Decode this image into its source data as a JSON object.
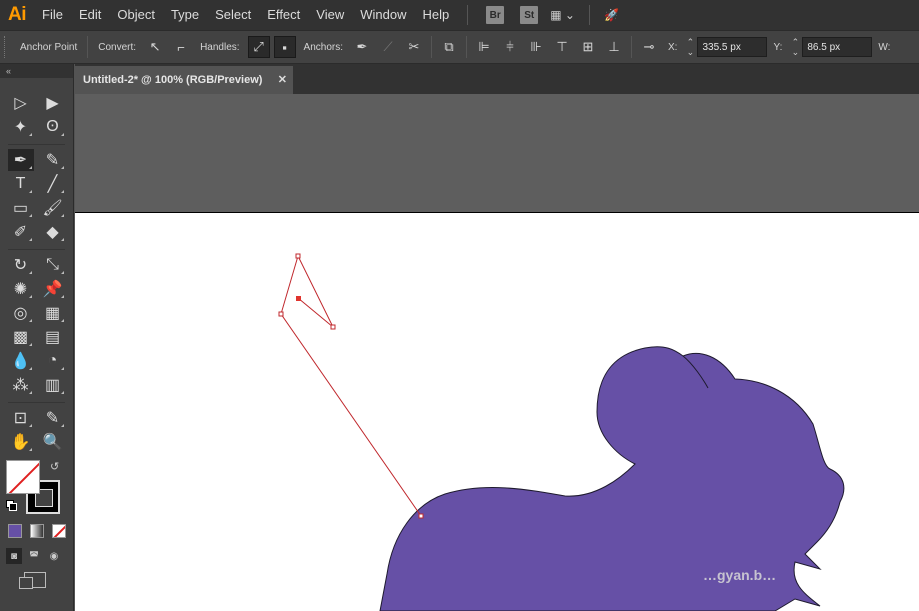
{
  "app": {
    "logo": "Ai"
  },
  "menu": {
    "items": [
      "File",
      "Edit",
      "Object",
      "Type",
      "Select",
      "Effect",
      "View",
      "Window",
      "Help"
    ],
    "bridge": "Br",
    "stock": "St"
  },
  "control": {
    "tool_name": "Anchor Point",
    "convert_label": "Convert:",
    "handles_label": "Handles:",
    "anchors_label": "Anchors:",
    "x_label": "X:",
    "x_value": "335.5 px",
    "y_label": "Y:",
    "y_value": "86.5 px",
    "w_label": "W:"
  },
  "document": {
    "tab_title": "Untitled-2* @ 100% (RGB/Preview)",
    "close_glyph": "✕"
  },
  "colors": {
    "fill": "#6650a6",
    "path_stroke": "#c0282d",
    "selection": "#e0342e"
  },
  "tools": [
    [
      "selection-icon",
      "direct-selection-icon"
    ],
    [
      "magic-wand-icon",
      "lasso-icon"
    ],
    [
      "pen-icon",
      "curvature-icon"
    ],
    [
      "type-icon",
      "line-segment-icon"
    ],
    [
      "rectangle-icon",
      "paintbrush-icon"
    ],
    [
      "shaper-icon",
      "eraser-icon"
    ],
    [
      "rotate-icon",
      "scale-icon"
    ],
    [
      "warp-icon",
      "free-transform-icon"
    ],
    [
      "shape-builder-icon",
      "perspective-grid-icon"
    ],
    [
      "mesh-icon",
      "gradient-icon"
    ],
    [
      "eyedropper-icon",
      "blend-icon"
    ],
    [
      "symbol-sprayer-icon",
      "column-graph-icon"
    ],
    [
      "artboard-icon",
      "slice-icon"
    ],
    [
      "hand-icon",
      "zoom-icon"
    ]
  ],
  "watermark": "…gyan.b…"
}
